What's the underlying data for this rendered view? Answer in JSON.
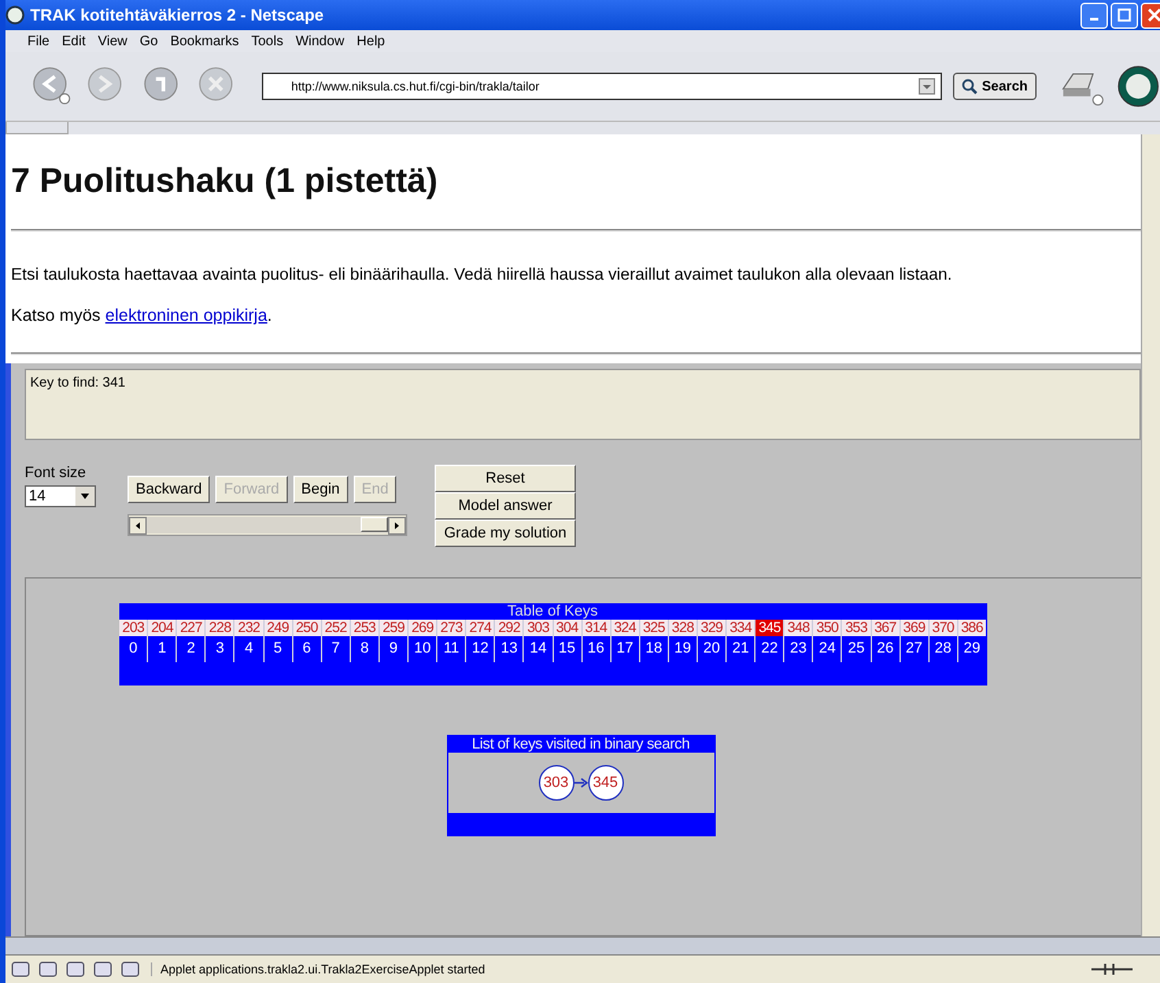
{
  "window": {
    "title": "TRAK kotitehtäväkierros 2 - Netscape"
  },
  "menu": [
    "File",
    "Edit",
    "View",
    "Go",
    "Bookmarks",
    "Tools",
    "Window",
    "Help"
  ],
  "toolbar": {
    "url": "http://www.niksula.cs.hut.fi/cgi-bin/trakla/tailor",
    "search_button": "Search"
  },
  "page": {
    "heading": "7 Puolitushaku (1 pistettä)",
    "paragraph": "Etsi taulukosta haettavaa avainta puolitus- eli binäärihaulla. Vedä hiirellä haussa vieraillut avaimet taulukon alla olevaan listaan.",
    "see_also": "Katso myös ",
    "link": "elektroninen oppikirja",
    "link_end": "."
  },
  "applet": {
    "message": "Key to find: 341",
    "font_size_label": "Font size",
    "font_size_value": "14",
    "nav_buttons": [
      {
        "label": "Backward",
        "disabled": false
      },
      {
        "label": "Forward",
        "disabled": true
      },
      {
        "label": "Begin",
        "disabled": false
      },
      {
        "label": "End",
        "disabled": true
      }
    ],
    "step_slider": {
      "level": 1
    },
    "action_buttons": [
      "Reset",
      "Model answer",
      "Grade my solution"
    ],
    "table": {
      "title": "Table of Keys",
      "cells": [
        {
          "key": "203",
          "index": "0",
          "selected": false
        },
        {
          "key": "204",
          "index": "1",
          "selected": false
        },
        {
          "key": "227",
          "index": "2",
          "selected": false
        },
        {
          "key": "228",
          "index": "3",
          "selected": false
        },
        {
          "key": "232",
          "index": "4",
          "selected": false
        },
        {
          "key": "249",
          "index": "5",
          "selected": false
        },
        {
          "key": "250",
          "index": "6",
          "selected": false
        },
        {
          "key": "252",
          "index": "7",
          "selected": false
        },
        {
          "key": "253",
          "index": "8",
          "selected": false
        },
        {
          "key": "259",
          "index": "9",
          "selected": false
        },
        {
          "key": "269",
          "index": "10",
          "selected": false
        },
        {
          "key": "273",
          "index": "11",
          "selected": false
        },
        {
          "key": "274",
          "index": "12",
          "selected": false
        },
        {
          "key": "292",
          "index": "13",
          "selected": false
        },
        {
          "key": "303",
          "index": "14",
          "selected": false
        },
        {
          "key": "304",
          "index": "15",
          "selected": false
        },
        {
          "key": "314",
          "index": "16",
          "selected": false
        },
        {
          "key": "324",
          "index": "17",
          "selected": false
        },
        {
          "key": "325",
          "index": "18",
          "selected": false
        },
        {
          "key": "328",
          "index": "19",
          "selected": false
        },
        {
          "key": "329",
          "index": "20",
          "selected": false
        },
        {
          "key": "334",
          "index": "21",
          "selected": false
        },
        {
          "key": "345",
          "index": "22",
          "selected": true
        },
        {
          "key": "348",
          "index": "23",
          "selected": false
        },
        {
          "key": "350",
          "index": "24",
          "selected": false
        },
        {
          "key": "353",
          "index": "25",
          "selected": false
        },
        {
          "key": "367",
          "index": "26",
          "selected": false
        },
        {
          "key": "369",
          "index": "27",
          "selected": false
        },
        {
          "key": "370",
          "index": "28",
          "selected": false
        },
        {
          "key": "386",
          "index": "29",
          "selected": false
        }
      ]
    },
    "visited": {
      "title": "List of keys visited in binary search",
      "keys": [
        "303",
        "345"
      ]
    }
  },
  "status_bar": {
    "text": "Applet applications.trakla2.ui.Trakla2ExerciseApplet started"
  }
}
